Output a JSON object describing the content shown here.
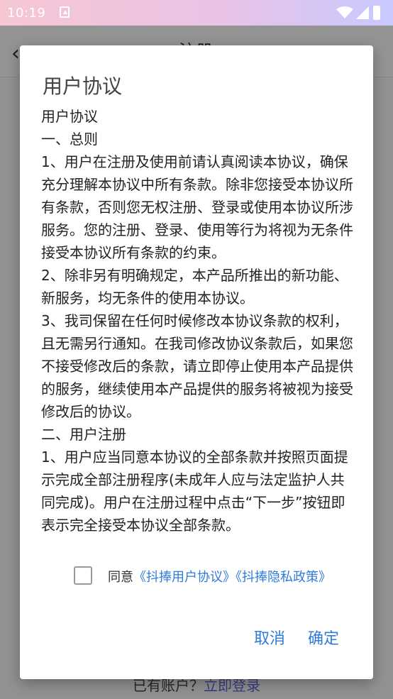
{
  "status_bar": {
    "time": "10:19",
    "icons": [
      "notification-icon",
      "wifi-icon",
      "signal-icon",
      "battery-icon"
    ]
  },
  "background": {
    "back_icon": "back-arrow-icon",
    "title": "注册",
    "login_prompt": "已有账户？",
    "login_link": "立即登录"
  },
  "dialog": {
    "title": "用户协议",
    "paragraphs": [
      "用户协议",
      "一、总则",
      "1、用户在注册及使用前请认真阅读本协议，确保充分理解本协议中所有条款。除非您接受本协议所有条款，否则您无权注册、登录或使用本协议所涉服务。您的注册、登录、使用等行为将视为无条件接受本协议所有条款的约束。",
      "2、除非另有明确规定，本产品所推出的新功能、新服务，均无条件的使用本协议。",
      "3、我司保留在任何时候修改本协议条款的权利，且无需另行通知。在我司修改协议条款后，如果您不接受修改后的条款，请立即停止使用本产品提供的服务，继续使用本产品提供的服务将被视为接受修改后的协议。",
      "二、用户注册",
      "1、用户应当同意本协议的全部条款并按照页面提示完成全部注册程序(未成年人应与法定监护人共同完成)。用户在注册过程中点击“下一步”按钮即表示完全接受本协议全部条款。"
    ],
    "agree": {
      "checked": false,
      "prefix": "同意",
      "link1": "《抖捧用户协议》",
      "link2": "《抖捧隐私政策》"
    },
    "cancel_label": "取消",
    "ok_label": "确定"
  },
  "colors": {
    "accent": "#2f7bd8",
    "status_bar_start": "#f6c6d3",
    "status_bar_end": "#c8c9ff"
  }
}
